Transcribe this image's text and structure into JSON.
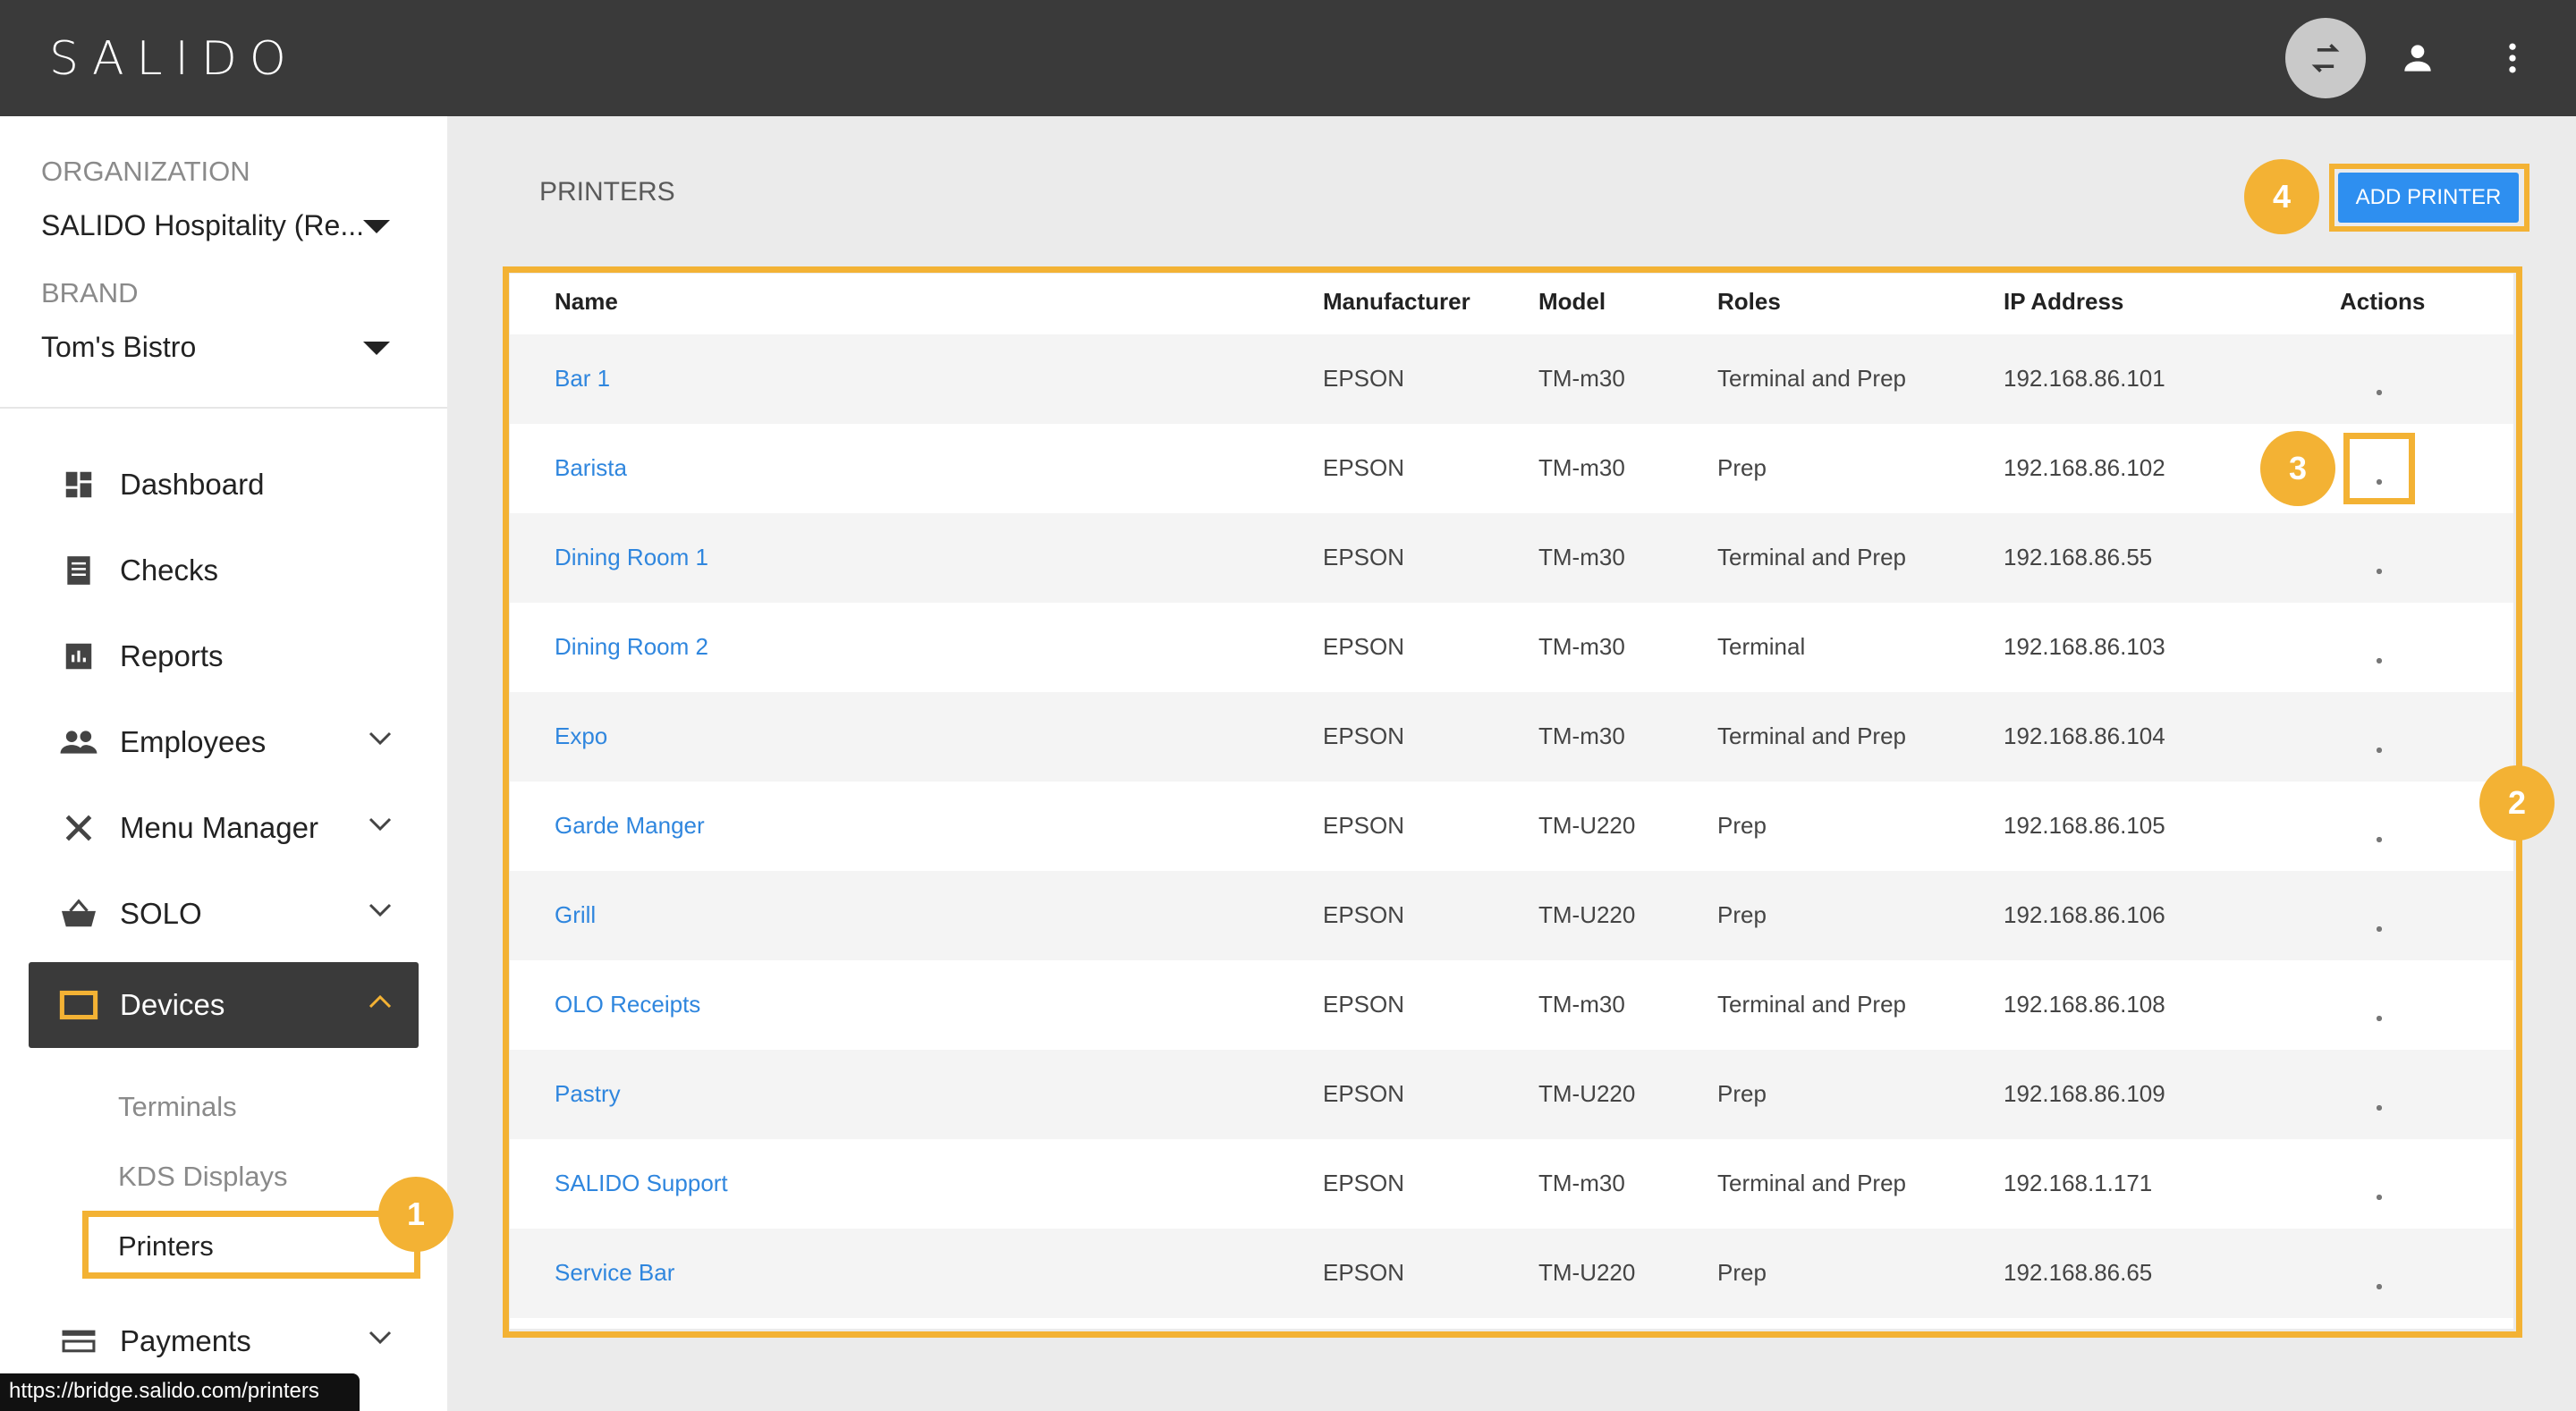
{
  "app": {
    "logo": "SALIDO"
  },
  "topbar": {
    "icons": [
      "sync-icon",
      "account-icon",
      "more-vert-icon"
    ]
  },
  "sidebar": {
    "organization_label": "ORGANIZATION",
    "organization_value": "SALIDO Hospitality (Re...",
    "brand_label": "BRAND",
    "brand_value": "Tom's Bistro",
    "nav": [
      {
        "label": "Dashboard",
        "icon": "dashboard-icon"
      },
      {
        "label": "Checks",
        "icon": "receipt-icon"
      },
      {
        "label": "Reports",
        "icon": "bar-chart-icon"
      },
      {
        "label": "Employees",
        "icon": "people-icon",
        "expandable": true
      },
      {
        "label": "Menu Manager",
        "icon": "utensils-icon",
        "expandable": true
      },
      {
        "label": "SOLO",
        "icon": "basket-icon",
        "expandable": true
      },
      {
        "label": "Devices",
        "icon": "devices-icon",
        "expandable": true,
        "active": true
      },
      {
        "label": "Payments",
        "icon": "credit-card-icon",
        "expandable": true
      }
    ],
    "sub_items": [
      "Terminals",
      "KDS Displays",
      "Printers"
    ]
  },
  "main": {
    "title": "PRINTERS",
    "add_button": "ADD PRINTER",
    "columns": [
      "Name",
      "Manufacturer",
      "Model",
      "Roles",
      "IP Address",
      "Actions"
    ],
    "rows": [
      {
        "name": "Bar 1",
        "manufacturer": "EPSON",
        "model": "TM-m30",
        "roles": "Terminal and Prep",
        "ip": "192.168.86.101"
      },
      {
        "name": "Barista",
        "manufacturer": "EPSON",
        "model": "TM-m30",
        "roles": "Prep",
        "ip": "192.168.86.102"
      },
      {
        "name": "Dining Room 1",
        "manufacturer": "EPSON",
        "model": "TM-m30",
        "roles": "Terminal and Prep",
        "ip": "192.168.86.55"
      },
      {
        "name": "Dining Room 2",
        "manufacturer": "EPSON",
        "model": "TM-m30",
        "roles": "Terminal",
        "ip": "192.168.86.103"
      },
      {
        "name": "Expo",
        "manufacturer": "EPSON",
        "model": "TM-m30",
        "roles": "Terminal and Prep",
        "ip": "192.168.86.104"
      },
      {
        "name": "Garde Manger",
        "manufacturer": "EPSON",
        "model": "TM-U220",
        "roles": "Prep",
        "ip": "192.168.86.105"
      },
      {
        "name": "Grill",
        "manufacturer": "EPSON",
        "model": "TM-U220",
        "roles": "Prep",
        "ip": "192.168.86.106"
      },
      {
        "name": "OLO Receipts",
        "manufacturer": "EPSON",
        "model": "TM-m30",
        "roles": "Terminal and Prep",
        "ip": "192.168.86.108"
      },
      {
        "name": "Pastry",
        "manufacturer": "EPSON",
        "model": "TM-U220",
        "roles": "Prep",
        "ip": "192.168.86.109"
      },
      {
        "name": "SALIDO Support",
        "manufacturer": "EPSON",
        "model": "TM-m30",
        "roles": "Terminal and Prep",
        "ip": "192.168.1.171"
      },
      {
        "name": "Service Bar",
        "manufacturer": "EPSON",
        "model": "TM-U220",
        "roles": "Prep",
        "ip": "192.168.86.65"
      }
    ]
  },
  "annotations": {
    "badges": [
      "1",
      "2",
      "3",
      "4"
    ],
    "highlight_color": "#f3b234"
  },
  "status_bar": {
    "url": "https://bridge.salido.com/printers"
  },
  "colors": {
    "topbar": "#3a3a3a",
    "link": "#2f86de",
    "button": "#2e8ff0",
    "accent": "#f3b234"
  }
}
